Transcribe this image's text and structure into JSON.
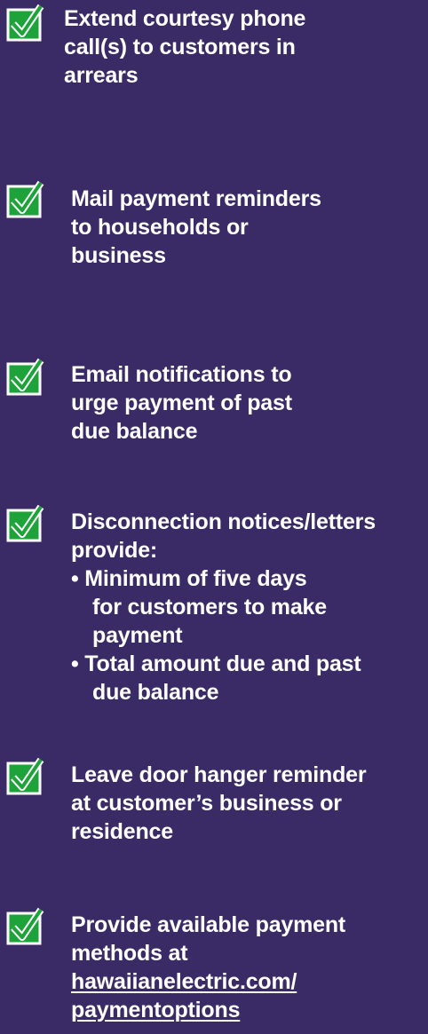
{
  "colors": {
    "background": "#3a2b66",
    "text": "#ffffff",
    "check_green": "#1ea33a",
    "check_border": "#ffffff"
  },
  "items": [
    {
      "icon": "checkbox-checked-icon",
      "lines": [
        "Extend courtesy phone",
        "call(s) to customers in",
        "arrears"
      ]
    },
    {
      "icon": "checkbox-checked-icon",
      "lines": [
        "Mail payment reminders",
        "to households or",
        "business"
      ]
    },
    {
      "icon": "checkbox-checked-icon",
      "lines": [
        "Email notifications to",
        "urge payment of past",
        "due balance"
      ]
    },
    {
      "icon": "checkbox-checked-icon",
      "lines": [
        "Disconnection notices/letters",
        "provide:"
      ],
      "bullets": [
        {
          "lines": [
            "• Minimum of five days",
            "for customers to make",
            "payment"
          ]
        },
        {
          "lines": [
            "• Total amount due and past",
            "due balance"
          ]
        }
      ]
    },
    {
      "icon": "checkbox-checked-icon",
      "lines": [
        "Leave door hanger reminder",
        "at customer’s business or",
        "residence"
      ]
    },
    {
      "icon": "checkbox-checked-icon",
      "lines": [
        "Provide available payment",
        "methods at"
      ],
      "link_lines": [
        "hawaiianelectric.com/",
        "paymentoptions"
      ]
    }
  ]
}
